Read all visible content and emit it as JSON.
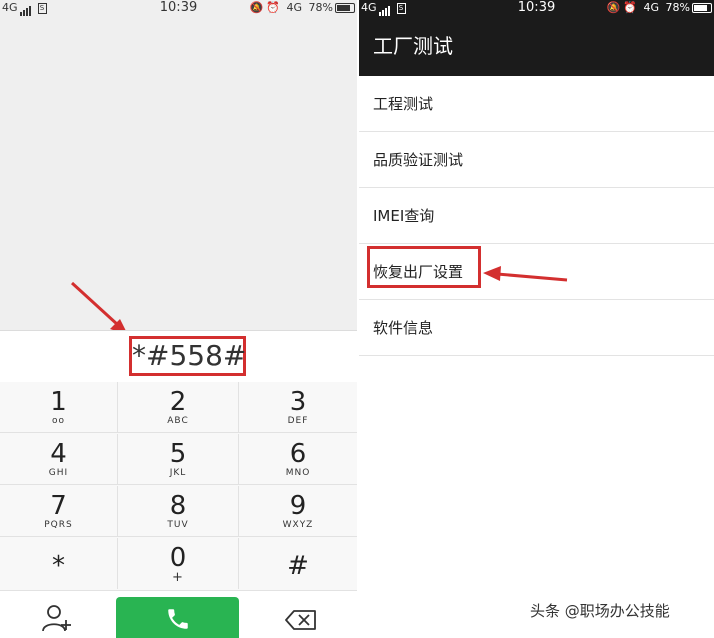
{
  "left_status": {
    "network": "4G",
    "sim_label": "S",
    "time": "10:39",
    "right_network": "4G",
    "battery": "78%",
    "battery_level": 0.78
  },
  "dialer": {
    "number": "*#558#",
    "keys": [
      {
        "digit": "1",
        "sub": "oo"
      },
      {
        "digit": "2",
        "sub": "ABC"
      },
      {
        "digit": "3",
        "sub": "DEF"
      },
      {
        "digit": "4",
        "sub": "GHI"
      },
      {
        "digit": "5",
        "sub": "JKL"
      },
      {
        "digit": "6",
        "sub": "MNO"
      },
      {
        "digit": "7",
        "sub": "PQRS"
      },
      {
        "digit": "8",
        "sub": "TUV"
      },
      {
        "digit": "9",
        "sub": "WXYZ"
      },
      {
        "digit": "*",
        "sub": ""
      },
      {
        "digit": "0",
        "sub": "+"
      },
      {
        "digit": "#",
        "sub": ""
      }
    ],
    "icons": {
      "add_contact": "add-contact-icon",
      "call": "phone-icon",
      "backspace": "backspace-icon"
    }
  },
  "right_status": {
    "network": "4G",
    "sim_label": "S",
    "time": "10:39",
    "right_network": "4G",
    "battery": "78%",
    "battery_level": 0.78
  },
  "factory_menu": {
    "title": "工厂测试",
    "items": [
      {
        "label": "工程测试"
      },
      {
        "label": "品质验证测试"
      },
      {
        "label": "IMEI查询"
      },
      {
        "label": "恢复出厂设置"
      },
      {
        "label": "软件信息"
      }
    ]
  },
  "watermark": "头条 @职场办公技能",
  "colors": {
    "highlight": "#d32f2f",
    "call_green": "#29b452",
    "appbar": "#1b1b1b"
  }
}
